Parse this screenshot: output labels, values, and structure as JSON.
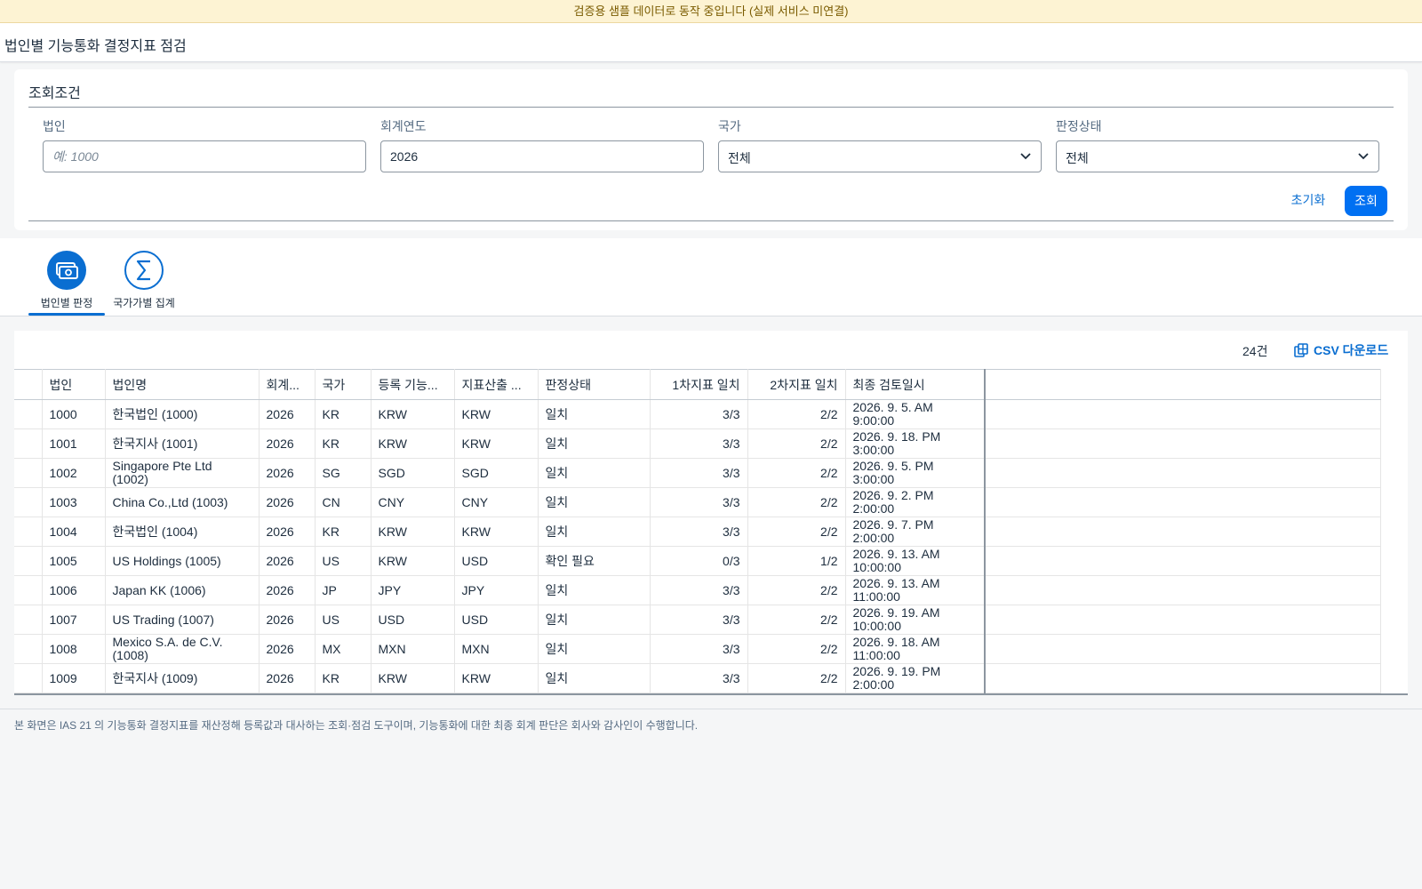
{
  "banner": {
    "text": "검증용 샘플 데이터로 동작 중입니다 (실제 서비스 미연결)"
  },
  "header": {
    "title": "법인별 기능통화 결정지표 점검"
  },
  "filters": {
    "title": "조회조건",
    "entity": {
      "label": "법인",
      "value": "",
      "placeholder": "예: 1000"
    },
    "fiscal_year": {
      "label": "회계연도",
      "value": "2026"
    },
    "country": {
      "label": "국가",
      "value": "전체"
    },
    "status": {
      "label": "판정상태",
      "value": "전체"
    },
    "reset_label": "초기화",
    "search_label": "조회"
  },
  "tabs": [
    {
      "label": "법인별 판정",
      "icon": "money-bills-icon",
      "active": true
    },
    {
      "label": "국가가별 집계",
      "icon": "sigma-icon",
      "active": false
    }
  ],
  "table": {
    "count": "24건",
    "csv_label": "CSV 다운로드",
    "columns": [
      "법인",
      "법인명",
      "회계...",
      "국가",
      "등록 기능...",
      "지표산출 ...",
      "판정상태",
      "1차지표 일치",
      "2차지표 일치",
      "최종 검토일시"
    ],
    "rows": [
      {
        "entity": "1000",
        "name": "한국법인 (1000)",
        "year": "2026",
        "country": "KR",
        "registered": "KRW",
        "calculated": "KRW",
        "status": "일치",
        "first": "3/3",
        "second": "2/2",
        "reviewed": "2026. 9. 5. AM 9:00:00"
      },
      {
        "entity": "1001",
        "name": "한국지사 (1001)",
        "year": "2026",
        "country": "KR",
        "registered": "KRW",
        "calculated": "KRW",
        "status": "일치",
        "first": "3/3",
        "second": "2/2",
        "reviewed": "2026. 9. 18. PM 3:00:00"
      },
      {
        "entity": "1002",
        "name": "Singapore Pte Ltd (1002)",
        "year": "2026",
        "country": "SG",
        "registered": "SGD",
        "calculated": "SGD",
        "status": "일치",
        "first": "3/3",
        "second": "2/2",
        "reviewed": "2026. 9. 5. PM 3:00:00"
      },
      {
        "entity": "1003",
        "name": "China Co.,Ltd (1003)",
        "year": "2026",
        "country": "CN",
        "registered": "CNY",
        "calculated": "CNY",
        "status": "일치",
        "first": "3/3",
        "second": "2/2",
        "reviewed": "2026. 9. 2. PM 2:00:00"
      },
      {
        "entity": "1004",
        "name": "한국법인 (1004)",
        "year": "2026",
        "country": "KR",
        "registered": "KRW",
        "calculated": "KRW",
        "status": "일치",
        "first": "3/3",
        "second": "2/2",
        "reviewed": "2026. 9. 7. PM 2:00:00"
      },
      {
        "entity": "1005",
        "name": "US Holdings (1005)",
        "year": "2026",
        "country": "US",
        "registered": "KRW",
        "calculated": "USD",
        "status": "확인 필요",
        "first": "0/3",
        "second": "1/2",
        "reviewed": "2026. 9. 13. AM 10:00:00"
      },
      {
        "entity": "1006",
        "name": "Japan KK (1006)",
        "year": "2026",
        "country": "JP",
        "registered": "JPY",
        "calculated": "JPY",
        "status": "일치",
        "first": "3/3",
        "second": "2/2",
        "reviewed": "2026. 9. 13. AM 11:00:00"
      },
      {
        "entity": "1007",
        "name": "US Trading (1007)",
        "year": "2026",
        "country": "US",
        "registered": "USD",
        "calculated": "USD",
        "status": "일치",
        "first": "3/3",
        "second": "2/2",
        "reviewed": "2026. 9. 19. AM 10:00:00"
      },
      {
        "entity": "1008",
        "name": "Mexico S.A. de C.V. (1008)",
        "year": "2026",
        "country": "MX",
        "registered": "MXN",
        "calculated": "MXN",
        "status": "일치",
        "first": "3/3",
        "second": "2/2",
        "reviewed": "2026. 9. 18. AM 11:00:00"
      },
      {
        "entity": "1009",
        "name": "한국지사 (1009)",
        "year": "2026",
        "country": "KR",
        "registered": "KRW",
        "calculated": "KRW",
        "status": "일치",
        "first": "3/3",
        "second": "2/2",
        "reviewed": "2026. 9. 19. PM 2:00:00"
      }
    ]
  },
  "footer": {
    "note": "본 화면은 IAS 21 의 기능통화 결정지표를 재산정해 등록값과 대사하는 조회·점검 도구이며, 기능통화에 대한 최종 회계 판단은 회사와 감사인이 수행합니다."
  },
  "colors": {
    "accent": "#0a6ed1",
    "ok": "#256f3a",
    "warn": "#c35500",
    "banner": "#fdf3d3"
  }
}
